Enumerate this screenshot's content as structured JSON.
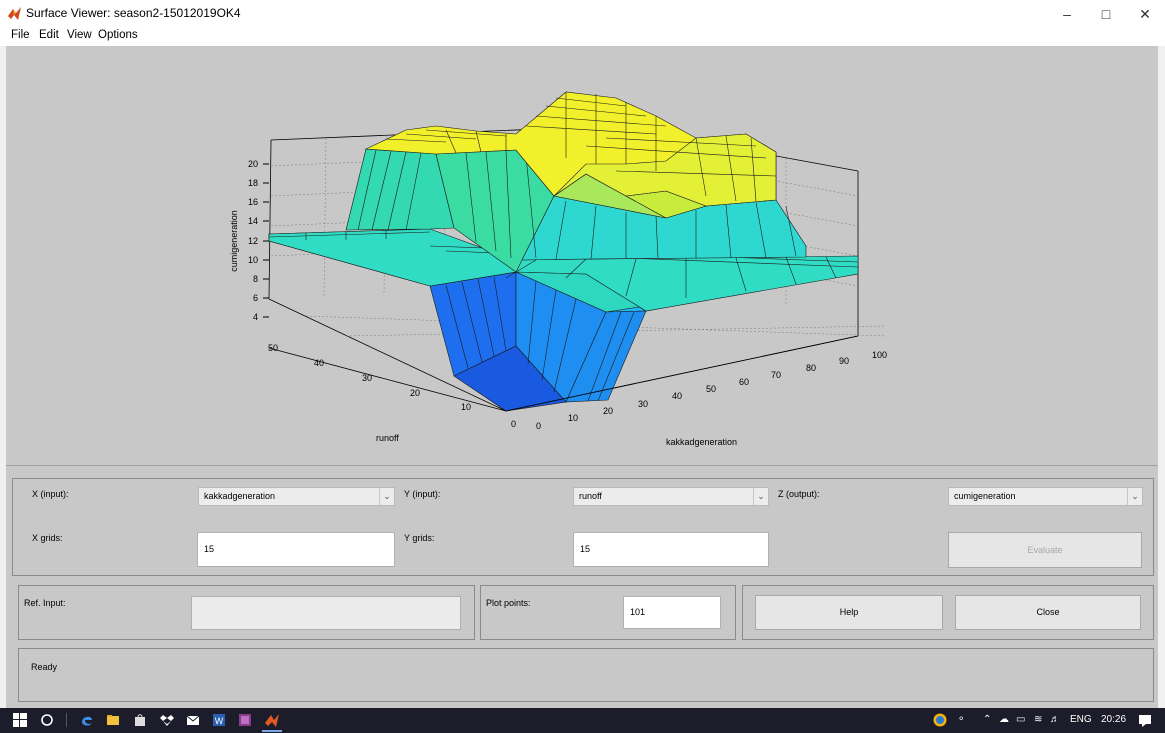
{
  "window": {
    "title": "Surface Viewer: season2-15012019OK4",
    "controls": {
      "minimize": "–",
      "maximize": "□",
      "close": "✕"
    }
  },
  "menu": {
    "items": [
      "File",
      "Edit",
      "View",
      "Options"
    ]
  },
  "plot": {
    "zlabel": "cumigeneration",
    "xlabel": "kakkadgeneration",
    "ylabel": "runoff",
    "zticks": [
      "4",
      "6",
      "8",
      "10",
      "12",
      "14",
      "16",
      "18",
      "20"
    ],
    "yticks": [
      "0",
      "10",
      "20",
      "30",
      "40",
      "50"
    ],
    "xticks": [
      "0",
      "10",
      "20",
      "30",
      "40",
      "50",
      "60",
      "70",
      "80",
      "90",
      "100"
    ],
    "colors": {
      "low": "#1e64f0",
      "mid": "#28d2c8",
      "high": "#f0f028",
      "background": "#c8c8c8"
    }
  },
  "controls": {
    "x_input_label": "X (input):",
    "x_input_value": "kakkadgeneration",
    "y_input_label": "Y (input):",
    "y_input_value": "runoff",
    "z_output_label": "Z (output):",
    "z_output_value": "cumigeneration",
    "x_grids_label": "X grids:",
    "x_grids_value": "15",
    "y_grids_label": "Y grids:",
    "y_grids_value": "15",
    "evaluate_label": "Evaluate",
    "ref_input_label": "Ref. Input:",
    "ref_input_value": "",
    "plot_points_label": "Plot points:",
    "plot_points_value": "101",
    "help_label": "Help",
    "close_label": "Close",
    "status_text": "Ready"
  },
  "taskbar": {
    "icons": [
      "windows-start-icon",
      "cortana-icon",
      "edge-icon",
      "file-explorer-icon",
      "store-icon",
      "dropbox-icon",
      "mail-icon",
      "word-icon",
      "winrar-icon",
      "matlab-icon"
    ],
    "tray_language": "ENG",
    "tray_time": "20:26"
  }
}
